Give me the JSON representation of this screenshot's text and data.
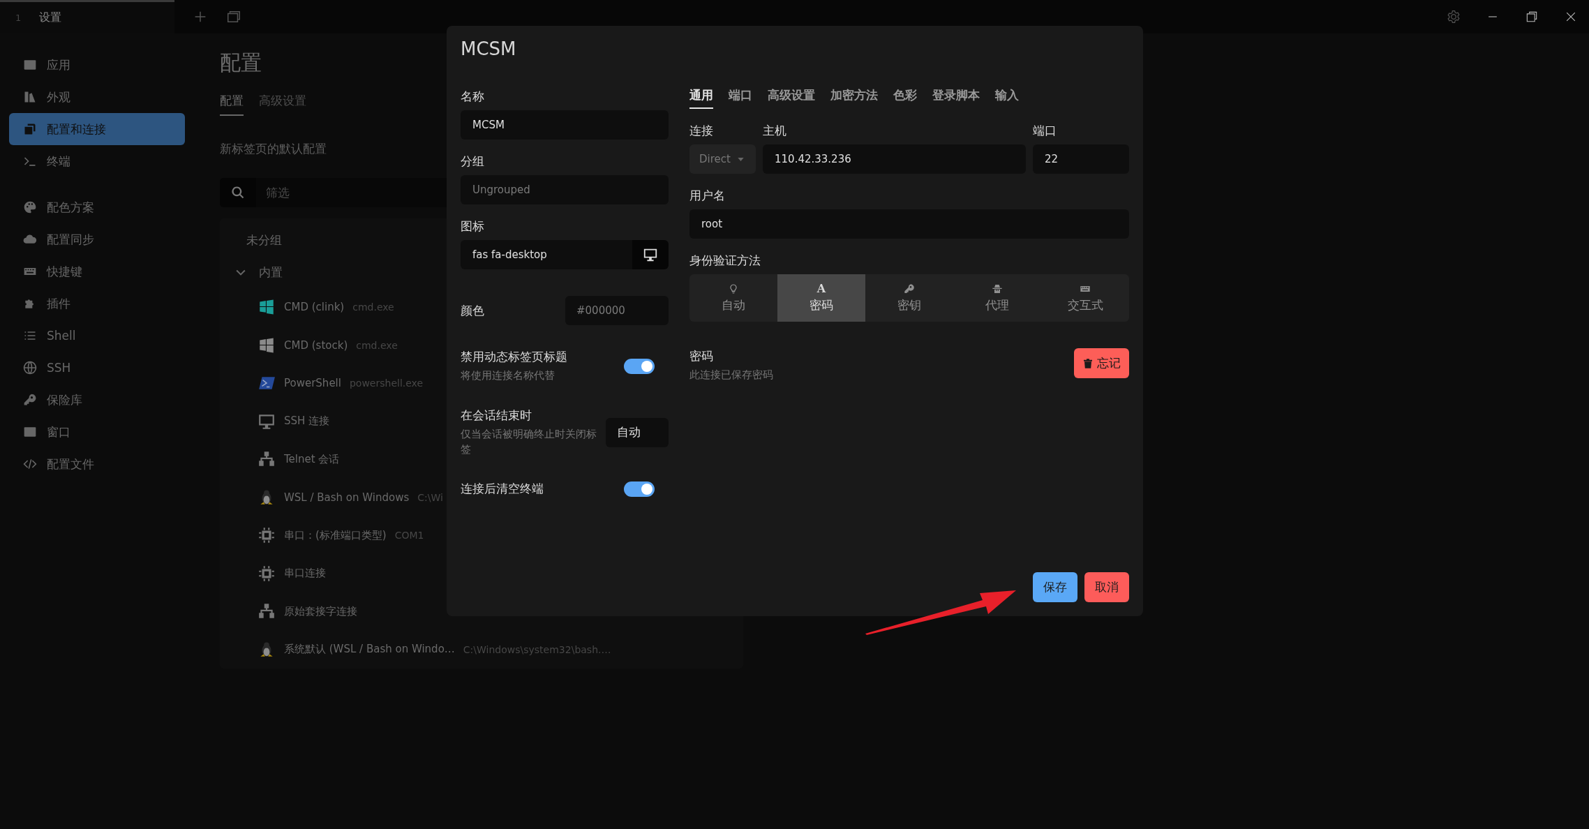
{
  "titlebar": {
    "tabs": [
      {
        "index": "1",
        "title": "设置",
        "selected": true
      }
    ]
  },
  "sidebar": {
    "groups": [
      [
        {
          "label": "应用",
          "kind": "window",
          "selected": false
        },
        {
          "label": "外观",
          "kind": "paint",
          "selected": false
        },
        {
          "label": "配置和连接",
          "kind": "layers",
          "selected": true
        },
        {
          "label": "终端",
          "kind": "terminal",
          "selected": false
        }
      ],
      [
        {
          "label": "配色方案",
          "kind": "palette",
          "selected": false
        },
        {
          "label": "配置同步",
          "kind": "cloud",
          "selected": false
        },
        {
          "label": "快捷键",
          "kind": "keyboard",
          "selected": false
        },
        {
          "label": "插件",
          "kind": "puzzle",
          "selected": false
        },
        {
          "label": "Shell",
          "kind": "list",
          "selected": false
        },
        {
          "label": "SSH",
          "kind": "globe",
          "selected": false
        },
        {
          "label": "保险库",
          "kind": "key",
          "selected": false
        },
        {
          "label": "窗口",
          "kind": "window",
          "selected": false
        },
        {
          "label": "配置文件",
          "kind": "code",
          "selected": false
        }
      ]
    ]
  },
  "main": {
    "title": "配置",
    "tabs": [
      {
        "label": "配置",
        "selected": true
      },
      {
        "label": "高级设置",
        "selected": false
      }
    ],
    "section": "新标签页的默认配置",
    "search": {
      "placeholder": "筛选"
    },
    "groups": [
      {
        "name": "未分组"
      },
      {
        "name": "内置",
        "expanded": true,
        "children": [
          {
            "name": "CMD (clink)",
            "detail": "cmd.exe",
            "kind": "windows",
            "color": "#1a9e98"
          },
          {
            "name": "CMD (stock)",
            "detail": "cmd.exe",
            "kind": "windows",
            "color": "#8a8a8a"
          },
          {
            "name": "PowerShell",
            "detail": "powershell.exe",
            "kind": "powershell"
          },
          {
            "name": "SSH 连接",
            "kind": "monitor"
          },
          {
            "name": "Telnet 会话",
            "kind": "network"
          },
          {
            "name": "WSL / Bash on Windows",
            "detail": "C:\\Wi",
            "kind": "penguin"
          },
          {
            "name": "串口：(标准端口类型)",
            "detail": "COM1",
            "kind": "chip"
          },
          {
            "name": "串口连接",
            "kind": "chip"
          },
          {
            "name": "原始套接字连接",
            "kind": "network"
          },
          {
            "name": "系统默认 (WSL / Bash on Windo…",
            "detail": "C:\\Windows\\system32\\bash.…",
            "kind": "penguin"
          }
        ]
      }
    ]
  },
  "dialog": {
    "title": "MCSM",
    "name": {
      "label": "名称",
      "value": "MCSM"
    },
    "group": {
      "label": "分组",
      "placeholder": "Ungrouped"
    },
    "icon": {
      "label": "图标",
      "value": "fas fa-desktop"
    },
    "color": {
      "label": "颜色",
      "placeholder": "#000000"
    },
    "options": [
      {
        "kind": "toggle",
        "label": "禁用动态标签页标题",
        "hint": "将使用连接名称代替",
        "on": true
      },
      {
        "kind": "select",
        "label": "在会话结束时",
        "hint": "仅当会话被明确终止时关闭标签",
        "value": "自动"
      },
      {
        "kind": "toggle",
        "label": "连接后清空终端",
        "on": true
      }
    ],
    "tabs": [
      {
        "label": "通用",
        "selected": true
      },
      {
        "label": "端口",
        "selected": false
      },
      {
        "label": "高级设置",
        "selected": false
      },
      {
        "label": "加密方法",
        "selected": false
      },
      {
        "label": "色彩",
        "selected": false
      },
      {
        "label": "登录脚本",
        "selected": false
      },
      {
        "label": "输入",
        "selected": false
      }
    ],
    "connection": {
      "label": "连接",
      "value": "Direct"
    },
    "host": {
      "label": "主机",
      "value": "110.42.33.236"
    },
    "port": {
      "label": "端口",
      "value": "22"
    },
    "username": {
      "label": "用户名",
      "value": "root"
    },
    "auth": {
      "label": "身份验证方法",
      "methods": [
        {
          "label": "自动",
          "kind": "bulb",
          "selected": false
        },
        {
          "label": "密码",
          "kind": "letter",
          "glyph": "A",
          "selected": true
        },
        {
          "label": "密钥",
          "kind": "key",
          "selected": false
        },
        {
          "label": "代理",
          "kind": "agent",
          "selected": false
        },
        {
          "label": "交互式",
          "kind": "keyboard",
          "selected": false
        }
      ]
    },
    "password": {
      "label": "密码",
      "hint": "此连接已保存密码",
      "button": "忘记"
    },
    "buttons": [
      {
        "label": "保存",
        "kind": "primary"
      },
      {
        "label": "取消",
        "kind": "danger"
      }
    ]
  }
}
